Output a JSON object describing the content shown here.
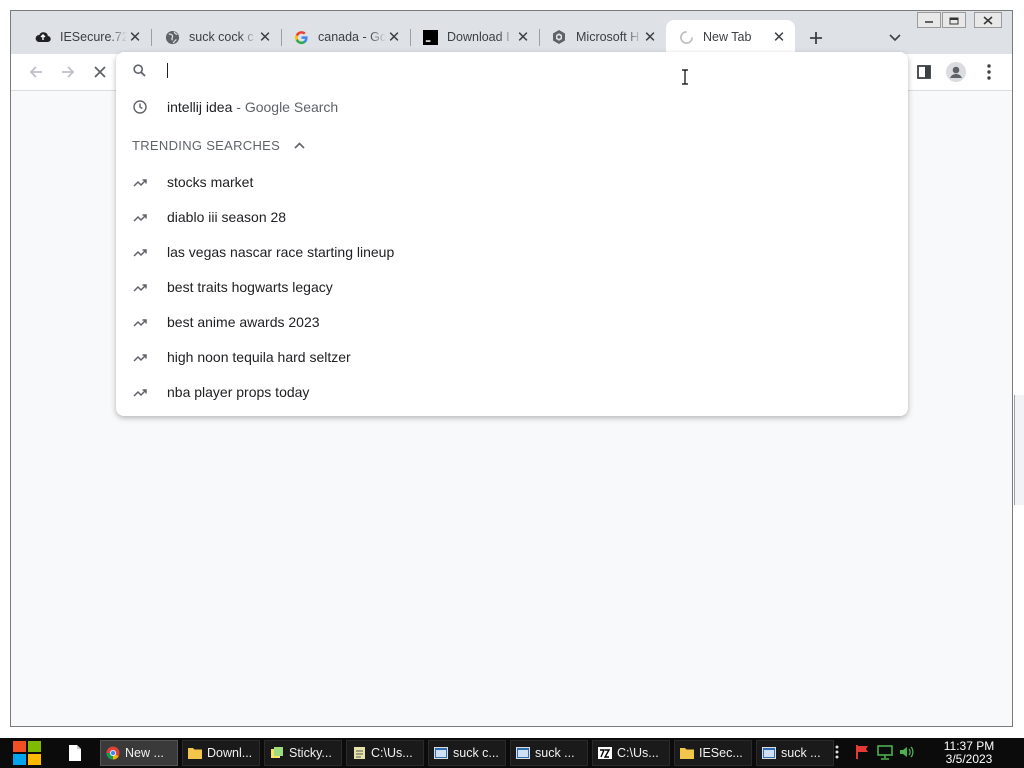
{
  "browser": {
    "tabs": [
      {
        "title": "IESecure.72",
        "icon": "cloud-upload-icon"
      },
      {
        "title": "suck cock c",
        "icon": "globe-icon"
      },
      {
        "title": "canada - Go",
        "icon": "google-icon"
      },
      {
        "title": "Download I",
        "icon": "terminal-icon"
      },
      {
        "title": "Microsoft H",
        "icon": "microsoft-icon"
      },
      {
        "title": "New Tab",
        "icon": "loading-spinner-icon",
        "active": true
      }
    ],
    "close_glyph": "✕"
  },
  "omnibox": {
    "value": "",
    "history_item": {
      "query": "intellij idea",
      "suffix": " - Google Search"
    },
    "trending_header": "TRENDING SEARCHES",
    "trending": [
      "stocks market",
      "diablo iii season 28",
      "las vegas nascar race starting lineup",
      "best traits hogwarts legacy",
      "best anime awards 2023",
      "high noon tequila hard seltzer",
      "nba player props today"
    ]
  },
  "taskbar": {
    "tasks": [
      {
        "label": "New ...",
        "icon": "chrome-icon",
        "active": true
      },
      {
        "label": "Downl...",
        "icon": "folder-icon"
      },
      {
        "label": "Sticky...",
        "icon": "sticky-notes-icon"
      },
      {
        "label": "C:\\Us...",
        "icon": "notepad-icon"
      },
      {
        "label": "suck c...",
        "icon": "window-icon"
      },
      {
        "label": "suck ...",
        "icon": "window-icon"
      },
      {
        "label": "C:\\Us...",
        "icon": "7zip-icon"
      },
      {
        "label": "IESec...",
        "icon": "folder-icon"
      },
      {
        "label": "suck ...",
        "icon": "window-icon"
      }
    ],
    "clock_time": "11:37 PM",
    "clock_date": "3/5/2023"
  },
  "colors": {
    "tabstrip": "#dee1e6",
    "taskbar": "#0b0b0b",
    "accent_google_blue": "#4285f4"
  }
}
